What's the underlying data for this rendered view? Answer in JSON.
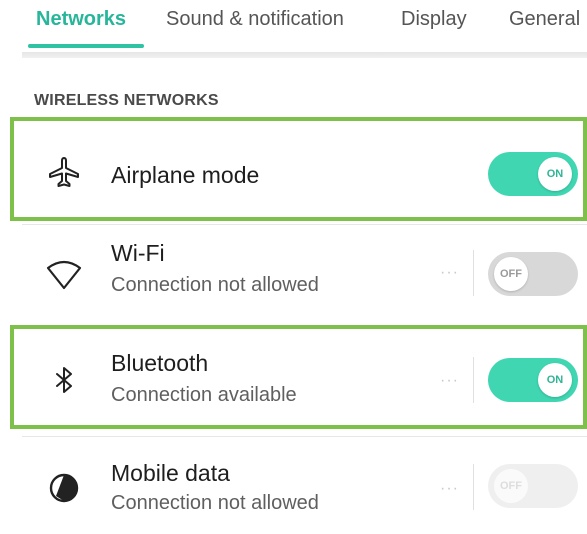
{
  "tabs": [
    {
      "label": "Networks",
      "active": true
    },
    {
      "label": "Sound & notification",
      "active": false
    },
    {
      "label": "Display",
      "active": false
    },
    {
      "label": "General",
      "active": false
    }
  ],
  "section": {
    "header": "WIRELESS NETWORKS"
  },
  "rows": [
    {
      "title": "Airplane mode",
      "subtitle": "",
      "icon": "airplane-icon",
      "toggle": "ON",
      "state": "on",
      "highlighted": true,
      "has_more": false
    },
    {
      "title": "Wi-Fi",
      "subtitle": "Connection not allowed",
      "icon": "wifi-icon",
      "toggle": "OFF",
      "state": "off",
      "highlighted": false,
      "has_more": true
    },
    {
      "title": "Bluetooth",
      "subtitle": "Connection available",
      "icon": "bluetooth-icon",
      "toggle": "ON",
      "state": "on",
      "highlighted": true,
      "has_more": true
    },
    {
      "title": "Mobile data",
      "subtitle": "Connection not allowed",
      "icon": "mobile-data-icon",
      "toggle": "OFF",
      "state": "disabled",
      "highlighted": false,
      "has_more": true
    }
  ],
  "more_glyph": "···",
  "colors": {
    "accent": "#2fc2a3",
    "toggle_on": "#3fd6b1",
    "highlight": "#7dc04a"
  }
}
